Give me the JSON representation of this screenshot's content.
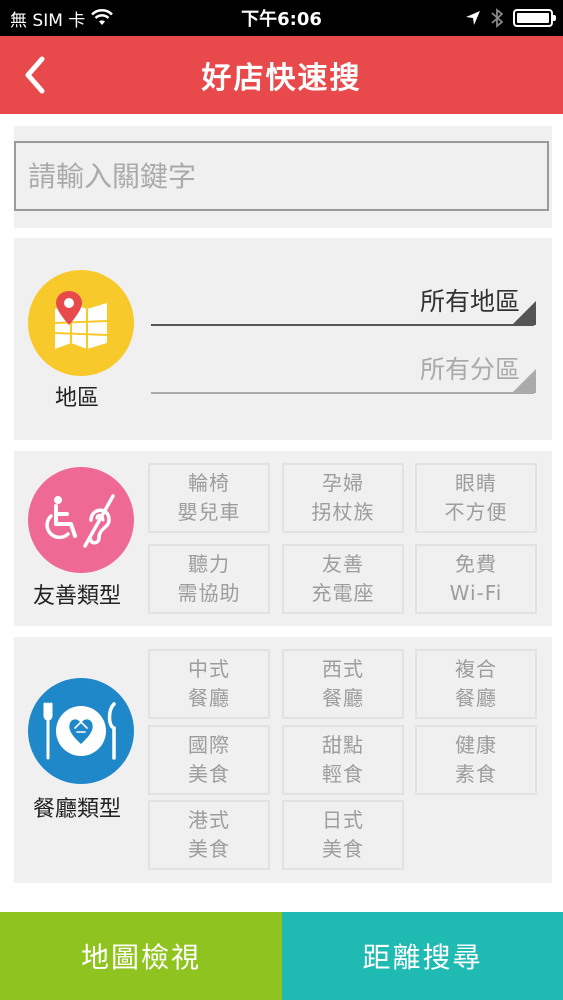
{
  "status_bar": {
    "carrier": "無 SIM 卡",
    "time": "下午6:06",
    "icons": [
      "wifi-icon",
      "location-arrow-icon",
      "bluetooth-icon",
      "battery-icon"
    ]
  },
  "nav": {
    "title": "好店快速搜",
    "back_icon": "chevron-left-icon"
  },
  "search": {
    "placeholder": "請輸入關鍵字",
    "value": ""
  },
  "region": {
    "label": "地區",
    "icon": "map-pin-icon",
    "city_select": "所有地區",
    "district_select": "所有分區"
  },
  "friendly_type": {
    "label": "友善類型",
    "icon": "accessibility-icon",
    "options": [
      "輪椅\n嬰兒車",
      "孕婦\n拐杖族",
      "眼睛\n不方便",
      "聽力\n需協助",
      "友善\n充電座",
      "免費\nWi-Fi"
    ]
  },
  "restaurant_type": {
    "label": "餐廳類型",
    "icon": "plate-cutlery-icon",
    "options": [
      "中式\n餐廳",
      "西式\n餐廳",
      "複合\n餐廳",
      "國際\n美食",
      "甜點\n輕食",
      "健康\n素食",
      "港式\n美食",
      "日式\n美食"
    ]
  },
  "actions": {
    "map_view": "地圖檢視",
    "distance_search": "距離搜尋"
  },
  "colors": {
    "header": "#e84a4c",
    "region_icon_bg": "#f7c92b",
    "type_icon_bg": "#ee6a95",
    "restaurant_icon_bg": "#1f88c8",
    "map_button": "#8fc31f",
    "distance_button": "#1fbab2"
  }
}
